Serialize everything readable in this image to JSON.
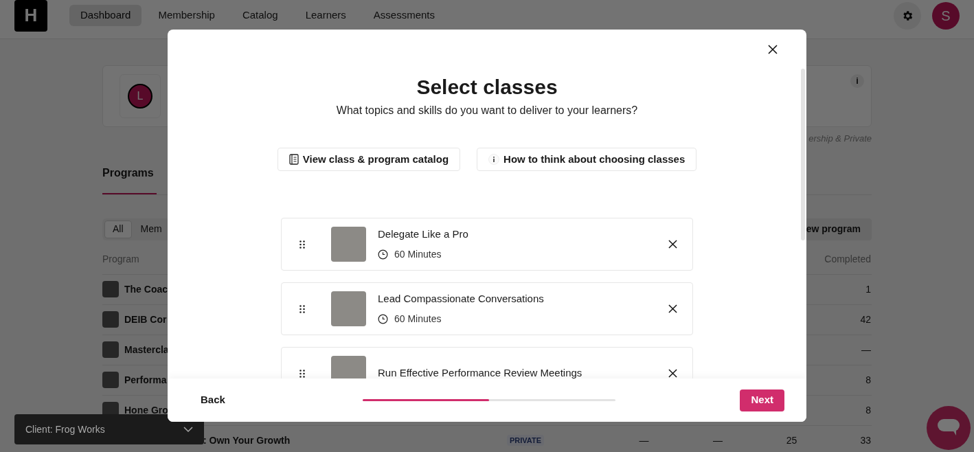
{
  "nav": {
    "logo": "H",
    "tabs": [
      {
        "label": "Dashboard",
        "selected": true
      },
      {
        "label": "Membership",
        "selected": false
      },
      {
        "label": "Catalog",
        "selected": false
      },
      {
        "label": "Learners",
        "selected": false
      },
      {
        "label": "Assessments",
        "selected": false
      }
    ],
    "avatar": "S"
  },
  "summary_card": {
    "avatar": "L",
    "info": "i",
    "caption": "ership & Private"
  },
  "page_tabs": [
    {
      "label": "Programs",
      "selected": true
    }
  ],
  "filters": [
    {
      "label": "All",
      "selected": true
    },
    {
      "label": "Mem",
      "selected": false
    }
  ],
  "new_program_button": "ew program",
  "table": {
    "columns": [
      "Program",
      "Completed"
    ],
    "rows": [
      {
        "kind": "full",
        "name": "The Coac",
        "completed": "1"
      },
      {
        "kind": "full",
        "name": "DEIB Cor",
        "completed": "42"
      },
      {
        "kind": "full",
        "name": "Mastercla",
        "completed": "—"
      },
      {
        "kind": "full",
        "name": "Performa",
        "completed": "8"
      },
      {
        "kind": "full",
        "name": "Hone Gro",
        "completed": "8"
      },
      {
        "kind": "covered",
        "name": ": Own Your Growth",
        "tag": "PRIVATE",
        "column_3": "—",
        "column_4": "—",
        "column_5": "25",
        "completed": "33"
      }
    ]
  },
  "client_selector": {
    "label": "Client: Frog Works"
  },
  "modal": {
    "title": "Select classes",
    "subtitle": "What topics and skills do you want to deliver to your learners?",
    "links": [
      {
        "kind": "catalog",
        "label": "View class & program catalog"
      },
      {
        "kind": "info",
        "label": "How to think about choosing classes"
      }
    ],
    "classes": [
      {
        "title": "Delegate Like a Pro",
        "duration": "60 Minutes"
      },
      {
        "title": "Lead Compassionate Conversations",
        "duration": "60 Minutes"
      },
      {
        "title": "Run Effective Performance Review Meetings"
      }
    ],
    "back": "Back",
    "progress": {
      "level": 0.5
    },
    "next": "Next"
  }
}
